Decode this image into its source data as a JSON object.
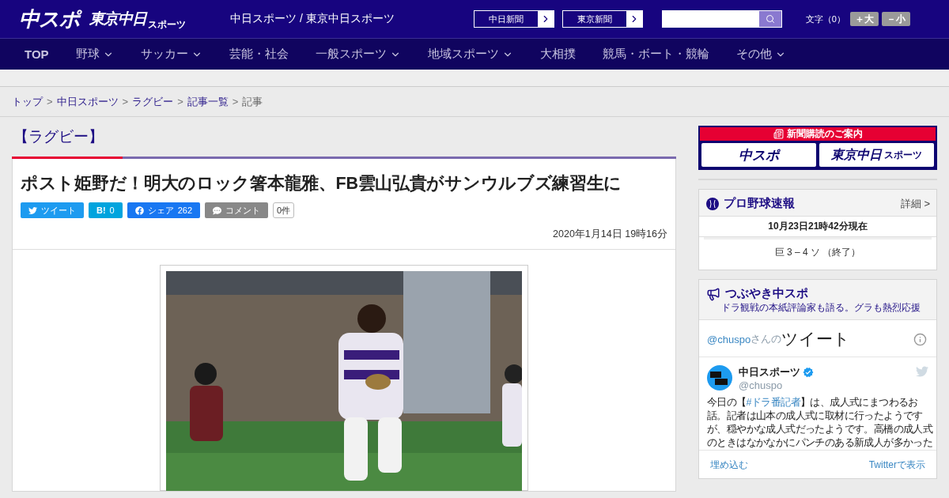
{
  "header": {
    "logo_main": "中スポ",
    "logo_tokyo": "東京中日",
    "logo_tokyo_sub": "スポーツ",
    "site_title": "中日スポーツ / 東京中日スポーツ",
    "paper_links": [
      {
        "label": "中日新聞"
      },
      {
        "label": "東京新聞"
      }
    ],
    "font_size": {
      "label": "文字（0）",
      "buttons": [
        {
          "label": "＋大"
        },
        {
          "label": "－小"
        }
      ]
    }
  },
  "nav": [
    {
      "label": "TOP",
      "dropdown": false
    },
    {
      "label": "野球",
      "dropdown": true
    },
    {
      "label": "サッカー",
      "dropdown": true
    },
    {
      "label": "芸能・社会",
      "dropdown": false
    },
    {
      "label": "一般スポーツ",
      "dropdown": true
    },
    {
      "label": "地域スポーツ",
      "dropdown": true
    },
    {
      "label": "大相撲",
      "dropdown": false
    },
    {
      "label": "競馬・ボート・競輪",
      "dropdown": false
    },
    {
      "label": "その他",
      "dropdown": true
    }
  ],
  "breadcrumb": [
    {
      "label": "トップ",
      "link": true
    },
    {
      "separator": ">",
      "label": "中日スポーツ",
      "link": true
    },
    {
      "separator": ">",
      "label": "ラグビー",
      "link": true
    },
    {
      "separator": ">",
      "label": "記事一覧",
      "link": true
    },
    {
      "separator": ">",
      "label": "記事",
      "link": false
    }
  ],
  "category": "【ラグビー】",
  "article": {
    "title": "ポスト姫野だ！明大のロック箸本龍雅、FB雲山弘貴がサンウルブズ練習生に",
    "share": [
      {
        "kind": "twitter",
        "label": "ツイート"
      },
      {
        "kind": "hatena",
        "label": "B!",
        "count": "0"
      },
      {
        "kind": "facebook",
        "label": "シェア",
        "count": "262"
      },
      {
        "kind": "comment",
        "label": "コメント"
      }
    ],
    "comment_count": "0件",
    "date": "2020年1月14日 19時16分"
  },
  "sidebar": {
    "subscribe": {
      "heading": "新聞購読のご案内",
      "logo_main": "中スポ",
      "logo_tokyo": "東京中日",
      "logo_tokyo_sub": "スポーツ"
    },
    "baseball": {
      "title": "プロ野球速報",
      "detail": "詳細 >",
      "updated": "10月23日21時42分現在",
      "score": "巨 3 – 4 ソ （終了）"
    },
    "tsubuyaki": {
      "title": "つぶやき中スポ",
      "subtitle": "ドラ観戦の本紙評論家も語る。グラも熱烈応援"
    },
    "twitter": {
      "handle": "@chuspo",
      "handle_suffix": "さんの",
      "heading": "ツイート",
      "name": "中日スポーツ",
      "verified": true,
      "screen_name": "@chuspo",
      "text_before": "今日の【",
      "hashtag": "#ドラ番記者",
      "text_after": "】は、成人式にまつわるお話。記者は山本の成人式に取材に行ったようですが、穏やかな成人式だったようです。高橋の成人式のときはなかなかにパンチのある新成人が多かった",
      "embed": "埋め込む",
      "view": "Twitterで表示"
    }
  }
}
